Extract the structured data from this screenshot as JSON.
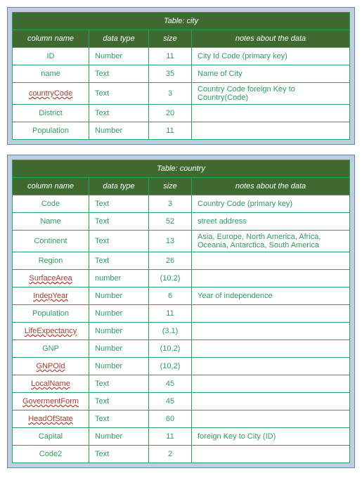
{
  "tables": [
    {
      "title": "Table: city",
      "headers": [
        "column name",
        "data type",
        "size",
        "notes about the data"
      ],
      "rows": [
        {
          "name": "ID",
          "squiggle": false,
          "type": "Number",
          "size": "11",
          "notes": "City Id Code (primary key)"
        },
        {
          "name": "name",
          "squiggle": false,
          "type": "Text",
          "size": "35",
          "notes": "Name of City"
        },
        {
          "name": "countryCode",
          "squiggle": true,
          "type": "Text",
          "size": "3",
          "notes": "Country Code foreign Key to Country(Code)"
        },
        {
          "name": "District",
          "squiggle": false,
          "type": "Text",
          "size": "20",
          "notes": ""
        },
        {
          "name": "Population",
          "squiggle": false,
          "type": "Number",
          "size": "11",
          "notes": ""
        }
      ]
    },
    {
      "title": "Table: country",
      "headers": [
        "column name",
        "data type",
        "size",
        "notes about the data"
      ],
      "rows": [
        {
          "name": "Code",
          "squiggle": false,
          "type": "Text",
          "size": "3",
          "notes": "Country Code (primary key)"
        },
        {
          "name": "Name",
          "squiggle": false,
          "type": "Text",
          "size": "52",
          "notes": "street address"
        },
        {
          "name": "Continent",
          "squiggle": false,
          "type": "Text",
          "size": "13",
          "notes": "Asia, Europe, North America, Africa, Oceania, Antarctica, South America"
        },
        {
          "name": "Region",
          "squiggle": false,
          "type": "Text",
          "size": "26",
          "notes": ""
        },
        {
          "name": "SurfaceArea",
          "squiggle": true,
          "type": "number",
          "size": "(10,2)",
          "notes": ""
        },
        {
          "name": "IndepYear",
          "squiggle": true,
          "type": "Number",
          "size": "6",
          "notes": "Year of independence"
        },
        {
          "name": "Population",
          "squiggle": false,
          "type": "Number",
          "size": "11",
          "notes": ""
        },
        {
          "name": "LifeExpectancy",
          "squiggle": true,
          "type": "Number",
          "size": "(3,1)",
          "notes": ""
        },
        {
          "name": "GNP",
          "squiggle": false,
          "type": "Number",
          "size": "(10,2)",
          "notes": ""
        },
        {
          "name": "GNPOld",
          "squiggle": true,
          "type": "Number",
          "size": "(10,2)",
          "notes": ""
        },
        {
          "name": "LocalName",
          "squiggle": true,
          "type": "Text",
          "size": "45",
          "notes": ""
        },
        {
          "name": "GovermentForm",
          "squiggle": true,
          "type": "Text",
          "size": "45",
          "notes": ""
        },
        {
          "name": "HeadOfState",
          "squiggle": true,
          "type": "Text",
          "size": "60",
          "notes": ""
        },
        {
          "name": "Capital",
          "squiggle": false,
          "type": "Number",
          "size": "11",
          "notes": "foreign Key to City (ID)"
        },
        {
          "name": "Code2",
          "squiggle": false,
          "type": "Text",
          "size": "2",
          "notes": ""
        }
      ]
    }
  ]
}
